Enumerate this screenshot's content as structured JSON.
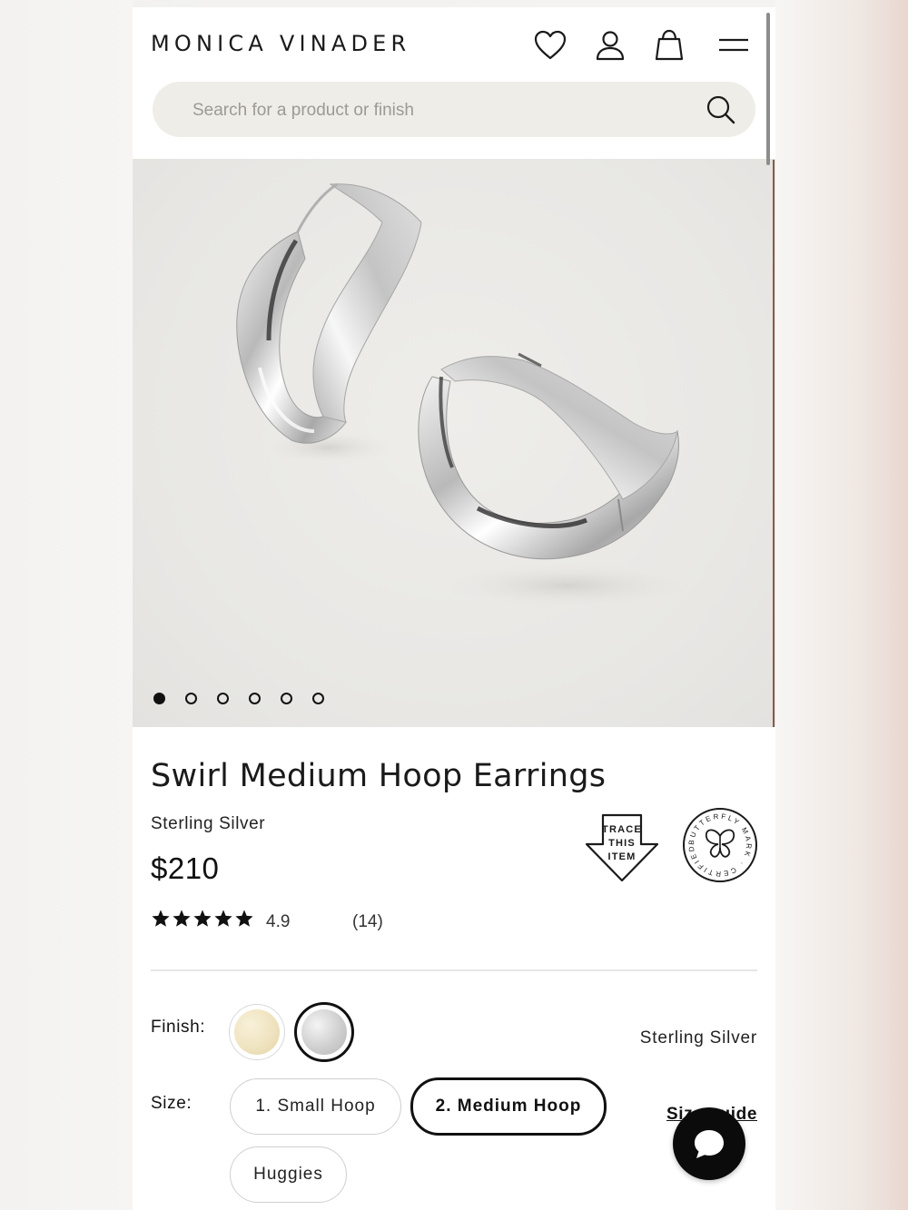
{
  "header": {
    "brand": "MONICA VINADER",
    "icons": [
      "heart-icon",
      "user-icon",
      "bag-icon",
      "menu-icon"
    ]
  },
  "search": {
    "placeholder": "Search for a product or finish",
    "icon": "search-icon"
  },
  "gallery": {
    "slide_count": 6,
    "active_slide": 1,
    "image": "silver swirl hoop earrings"
  },
  "product": {
    "title": "Swirl Medium Hoop Earrings",
    "material": "Sterling Silver",
    "price": "$210",
    "rating_value": "4.9",
    "rating_stars": 5,
    "review_count": "(14)",
    "badges": {
      "trace": [
        "TRACE",
        "THIS",
        "ITEM"
      ],
      "butterfly_ring": "BUTTERFLY MARK · CERTIFIED ·"
    }
  },
  "finish": {
    "label": "Finish:",
    "options": [
      {
        "name": "gold",
        "color": "#efe3c0"
      },
      {
        "name": "silver",
        "color": "#cfcfcf",
        "selected": true
      }
    ],
    "selected_value": "Sterling Silver"
  },
  "size": {
    "label": "Size:",
    "options": [
      "1. Small Hoop",
      "2. Medium Hoop",
      "Huggies"
    ],
    "selected_index": 1,
    "guide_label": "Size guide"
  },
  "chat": {
    "icon": "chat-bubble-icon"
  },
  "colors": {
    "accent": "#111111",
    "search_bg": "#efede7"
  }
}
